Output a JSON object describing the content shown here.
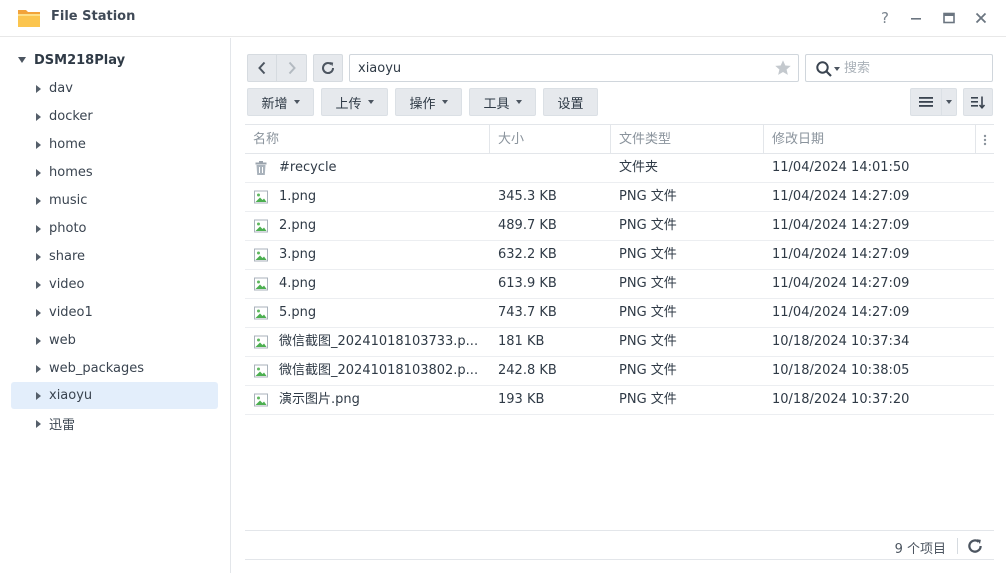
{
  "window": {
    "title": "File Station",
    "help_label": "?"
  },
  "sidebar": {
    "root": "DSM218Play",
    "items": [
      {
        "label": "dav"
      },
      {
        "label": "docker"
      },
      {
        "label": "home"
      },
      {
        "label": "homes"
      },
      {
        "label": "music"
      },
      {
        "label": "photo"
      },
      {
        "label": "share"
      },
      {
        "label": "video"
      },
      {
        "label": "video1"
      },
      {
        "label": "web"
      },
      {
        "label": "web_packages"
      },
      {
        "label": "xiaoyu",
        "selected": true
      },
      {
        "label": "迅雷"
      }
    ]
  },
  "toolbar": {
    "path": "xiaoyu",
    "search_placeholder": "搜索",
    "buttons": {
      "create": "新增",
      "upload": "上传",
      "action": "操作",
      "tools": "工具",
      "settings": "设置"
    }
  },
  "list": {
    "columns": {
      "name": "名称",
      "size": "大小",
      "type": "文件类型",
      "modified": "修改日期"
    },
    "rows": [
      {
        "name": "#recycle",
        "size": "",
        "type": "文件夹",
        "modified": "11/04/2024 14:01:50",
        "icon": "trash-icon"
      },
      {
        "name": "1.png",
        "size": "345.3 KB",
        "type": "PNG 文件",
        "modified": "11/04/2024 14:27:09",
        "icon": "image-file-icon"
      },
      {
        "name": "2.png",
        "size": "489.7 KB",
        "type": "PNG 文件",
        "modified": "11/04/2024 14:27:09",
        "icon": "image-file-icon"
      },
      {
        "name": "3.png",
        "size": "632.2 KB",
        "type": "PNG 文件",
        "modified": "11/04/2024 14:27:09",
        "icon": "image-file-icon"
      },
      {
        "name": "4.png",
        "size": "613.9 KB",
        "type": "PNG 文件",
        "modified": "11/04/2024 14:27:09",
        "icon": "image-file-icon"
      },
      {
        "name": "5.png",
        "size": "743.7 KB",
        "type": "PNG 文件",
        "modified": "11/04/2024 14:27:09",
        "icon": "image-file-icon"
      },
      {
        "name": "微信截图_20241018103733.p...",
        "size": "181 KB",
        "type": "PNG 文件",
        "modified": "10/18/2024 10:37:34",
        "icon": "image-file-icon"
      },
      {
        "name": "微信截图_20241018103802.p...",
        "size": "242.8 KB",
        "type": "PNG 文件",
        "modified": "10/18/2024 10:38:05",
        "icon": "image-file-icon"
      },
      {
        "name": "演示图片.png",
        "size": "193 KB",
        "type": "PNG 文件",
        "modified": "10/18/2024 10:37:20",
        "icon": "image-file-icon"
      }
    ]
  },
  "footer": {
    "count": "9 个项目"
  },
  "colors": {
    "accent": "#2f7ad6",
    "selected_bg": "#e3eefb",
    "image_icon_green": "#4caf50",
    "folder_orange": "#f5a623"
  }
}
